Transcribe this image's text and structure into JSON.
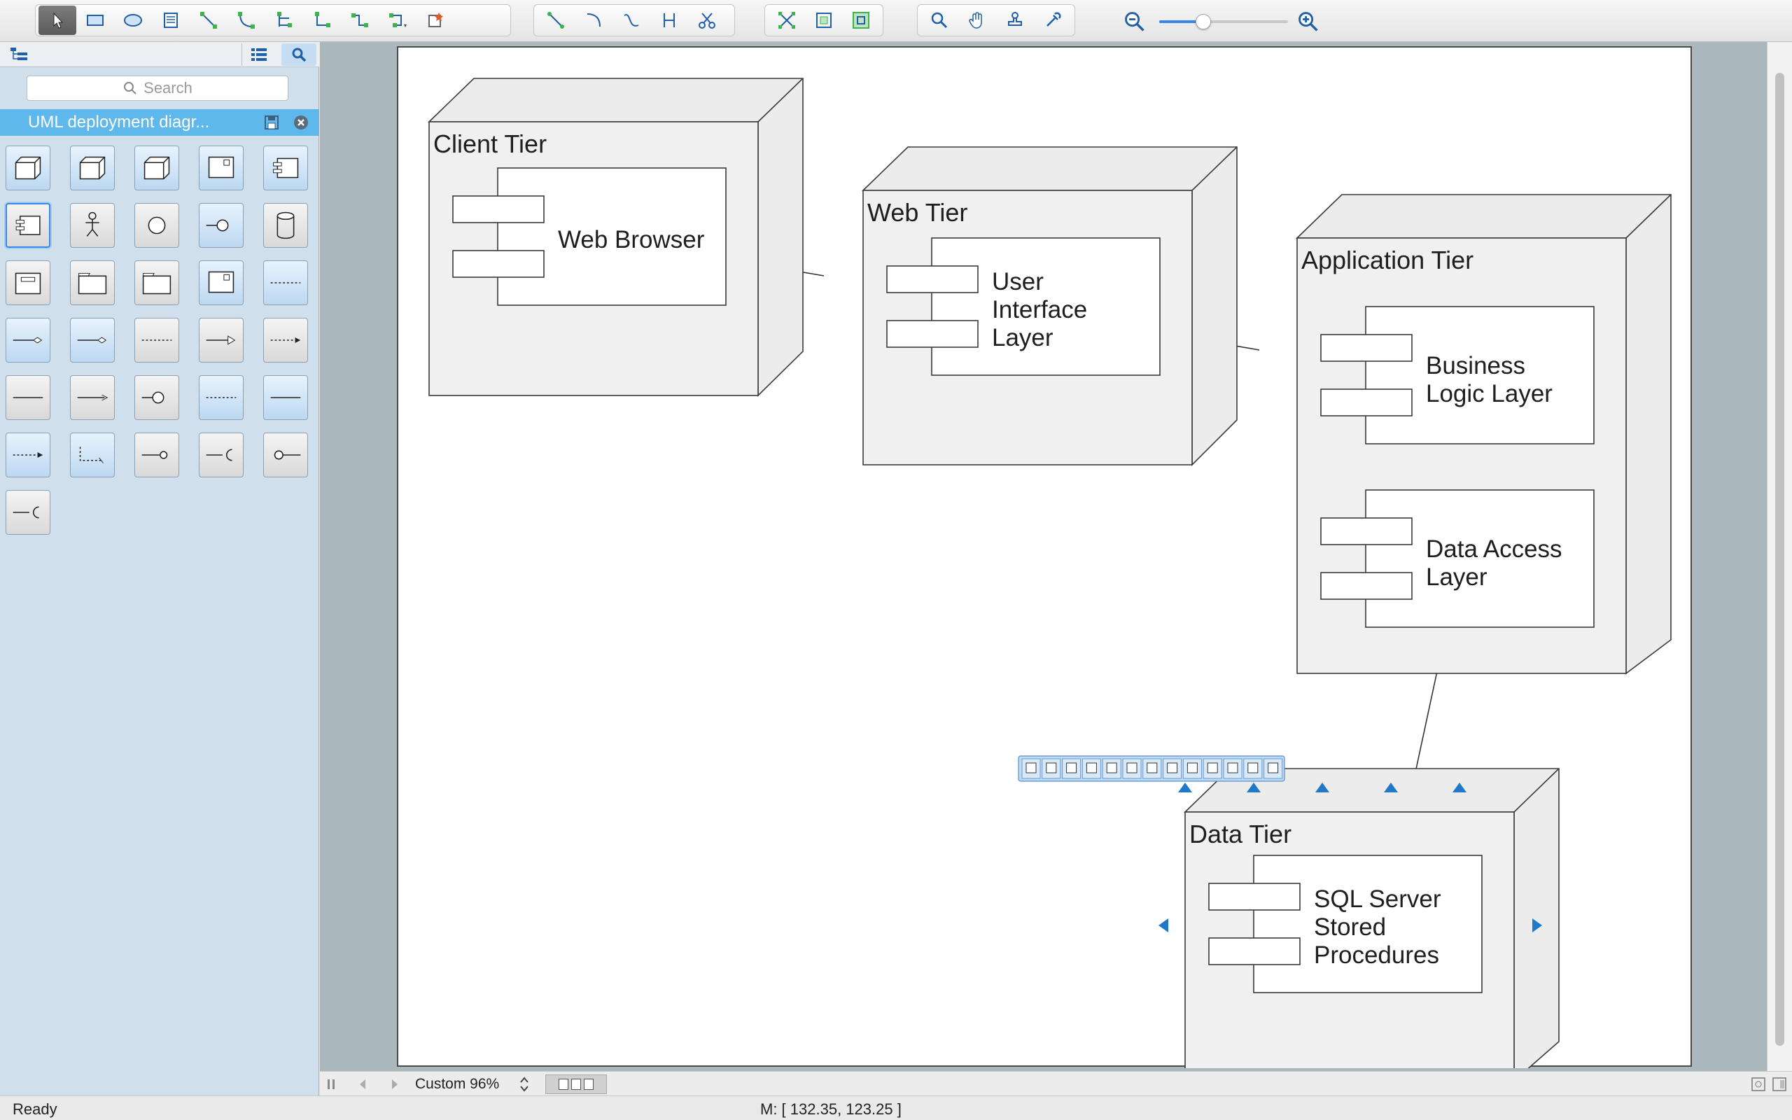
{
  "toolbar": {
    "tools": [
      {
        "name": "select-tool",
        "icon": "pointer-icon",
        "active": true
      },
      {
        "name": "rectangle-tool",
        "icon": "rectangle-icon"
      },
      {
        "name": "ellipse-tool",
        "icon": "ellipse-icon"
      },
      {
        "name": "text-tool",
        "icon": "text-block-icon"
      },
      {
        "name": "direct-connector-tool",
        "icon": "line-connector-icon"
      },
      {
        "name": "curved-connector-tool",
        "icon": "curve-connector-icon"
      },
      {
        "name": "tree-connector-tool",
        "icon": "tree-connector-icon"
      },
      {
        "name": "orthogonal-connector-tool",
        "icon": "orthogonal-connector-icon"
      },
      {
        "name": "rounded-connector-tool",
        "icon": "rounded-connector-icon"
      },
      {
        "name": "smart-connector-tool",
        "icon": "smart-connector-icon"
      },
      {
        "name": "insert-shape-tool",
        "icon": "insert-shape-icon"
      }
    ],
    "zoom_value_percent": 32
  },
  "sidebar": {
    "search_placeholder": "Search",
    "library_title": "UML deployment diagr...",
    "shape_count": 31
  },
  "diagram": {
    "nodes": [
      {
        "id": "client",
        "title": "Client Tier",
        "components": [
          [
            "Web Browser"
          ]
        ]
      },
      {
        "id": "web",
        "title": "Web Tier",
        "components": [
          [
            "User",
            "Interface",
            "Layer"
          ]
        ]
      },
      {
        "id": "app",
        "title": "Application Tier",
        "components": [
          [
            "Business",
            "Logic Layer"
          ],
          [
            "Data Access",
            "Layer"
          ]
        ]
      },
      {
        "id": "data",
        "title": "Data Tier",
        "components": [
          [
            "SQL Server",
            "Stored",
            "Procedures"
          ]
        ]
      }
    ]
  },
  "bottom": {
    "zoom_label": "Custom 96%"
  },
  "status": {
    "text": "Ready",
    "mouse_coords": "M: [ 132.35, 123.25 ]"
  },
  "colors": {
    "selection_blue": "#3b86e6",
    "library_header": "#5fb8ec",
    "canvas_bg": "#aab8bd",
    "node_fill": "#efefef"
  }
}
